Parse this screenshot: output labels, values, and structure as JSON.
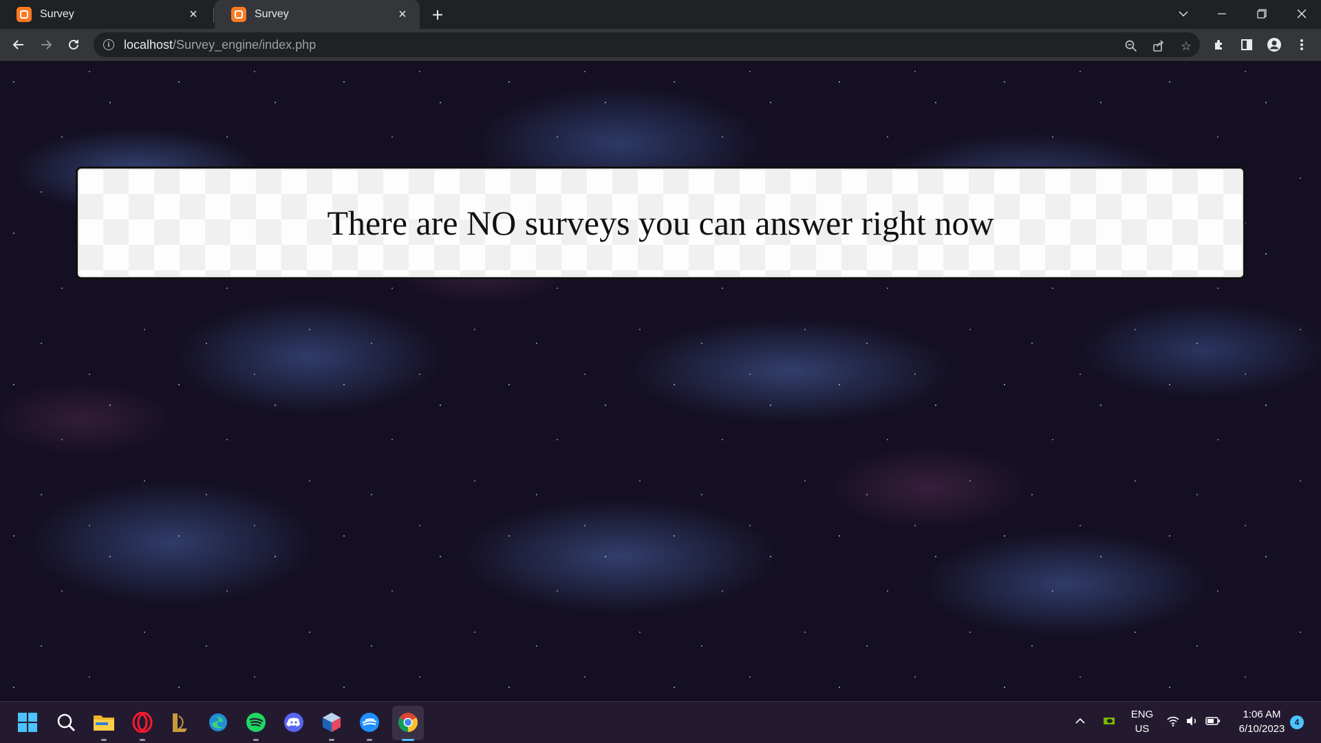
{
  "browser": {
    "tabs": [
      {
        "title": "Survey",
        "active": false
      },
      {
        "title": "Survey",
        "active": true
      }
    ],
    "new_tab_icon": "plus-icon",
    "window_controls": [
      "chevron-down-icon",
      "minimize-icon",
      "restore-icon",
      "close-icon"
    ],
    "url_host": "localhost",
    "url_path": "/Survey_engine/index.php",
    "toolbar_icons": [
      "back-icon",
      "forward-icon",
      "reload-icon",
      "zoom-icon",
      "share-icon",
      "bookmark-star-icon",
      "extensions-icon",
      "side-panel-icon",
      "profile-icon",
      "menu-icon"
    ],
    "favicon_color": "#fb7a24"
  },
  "page": {
    "message": "There are NO surveys you can answer right now"
  },
  "taskbar": {
    "apps": [
      "start-icon",
      "search-icon",
      "file-explorer-icon",
      "opera-icon",
      "league-icon",
      "edge-icon",
      "spotify-icon",
      "discord-icon",
      "virtualbox-icon",
      "app-icon",
      "chrome-icon"
    ],
    "language": "ENG",
    "region": "US",
    "time": "1:06 AM",
    "date": "6/10/2023",
    "notification_count": "4",
    "accent_color": "#4cc2ff"
  }
}
